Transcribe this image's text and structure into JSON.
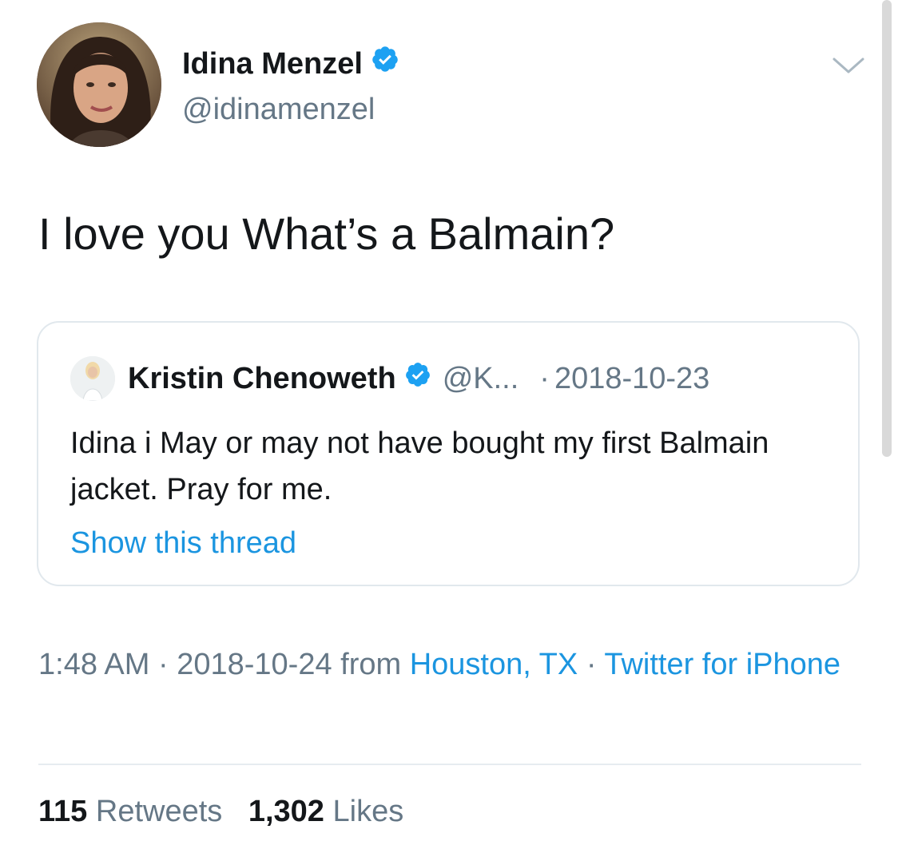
{
  "author": {
    "display_name": "Idina Menzel",
    "handle": "@idinamenzel",
    "verified": true
  },
  "tweet": {
    "text": "I love you What’s a Balmain?"
  },
  "quoted_tweet": {
    "display_name": "Kristin Chenoweth",
    "handle": "@K...",
    "separator": "·",
    "date": "2018-10-23",
    "text": "Idina i May or may not have bought my first Balmain jacket. Pray for me.",
    "thread_link": "Show this thread"
  },
  "meta": {
    "time": "1:48 AM",
    "dot1": "·",
    "date": "2018-10-24",
    "from_label": "from",
    "location": "Houston, TX",
    "dot2": "·",
    "source": "Twitter for iPhone"
  },
  "stats": {
    "retweets_count": "115",
    "retweets_label": "Retweets",
    "likes_count": "1,302",
    "likes_label": "Likes"
  },
  "colors": {
    "link": "#1b95e0",
    "secondary_text": "#657786",
    "verified": "#1da1f2"
  },
  "icons": {
    "verified": "verified-badge-icon",
    "menu": "chevron-down-icon"
  }
}
